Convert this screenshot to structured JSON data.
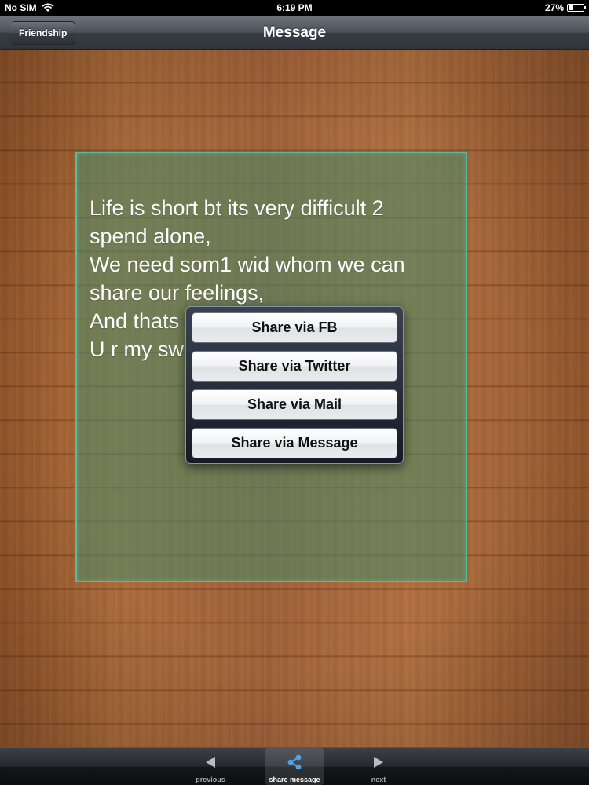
{
  "status_bar": {
    "carrier": "No SIM",
    "time": "6:19 PM",
    "battery": "27%",
    "battery_level": 0.27
  },
  "nav_bar": {
    "back_label": "Friendship",
    "title": "Message"
  },
  "message": {
    "text": "Life is short bt its very difficult 2\nspend alone,\nWe need som1 wid whom we can\nshare our feelings,\nAnd thats why i need u..\nU r my sweet friend"
  },
  "share_menu": {
    "items": [
      {
        "label": "Share via FB"
      },
      {
        "label": "Share via Twitter"
      },
      {
        "label": "Share via Mail"
      },
      {
        "label": "Share via Message"
      }
    ]
  },
  "toolbar": {
    "items": [
      {
        "label": "previous",
        "icon": "arrow-left-icon"
      },
      {
        "label": "share message",
        "icon": "share-icon",
        "selected": true
      },
      {
        "label": "next",
        "icon": "arrow-right-icon"
      }
    ]
  },
  "colors": {
    "card_border": "#57b9a0",
    "toolbar_selected": "#ffffff"
  }
}
